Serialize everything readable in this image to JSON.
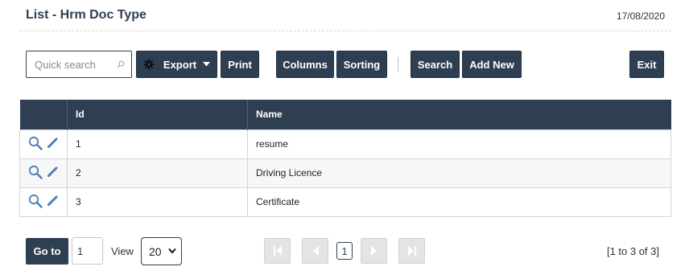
{
  "header": {
    "title": "List - Hrm Doc Type",
    "date": "17/08/2020"
  },
  "toolbar": {
    "search_placeholder": "Quick search",
    "export_label": "Export",
    "print_label": "Print",
    "columns_label": "Columns",
    "sorting_label": "Sorting",
    "search_label": "Search",
    "add_new_label": "Add New",
    "exit_label": "Exit"
  },
  "table": {
    "columns": [
      "Id",
      "Name"
    ],
    "rows": [
      {
        "id": "1",
        "name": "resume"
      },
      {
        "id": "2",
        "name": "Driving Licence"
      },
      {
        "id": "3",
        "name": "Certificate"
      }
    ]
  },
  "footer": {
    "goto_label": "Go to",
    "page_value": "1",
    "view_label": "View",
    "page_size": "20",
    "current_page": "1",
    "range_text": "[1 to 3 of 3]"
  },
  "colors": {
    "primary": "#2f3f52",
    "icon": "#4a7fb8"
  }
}
